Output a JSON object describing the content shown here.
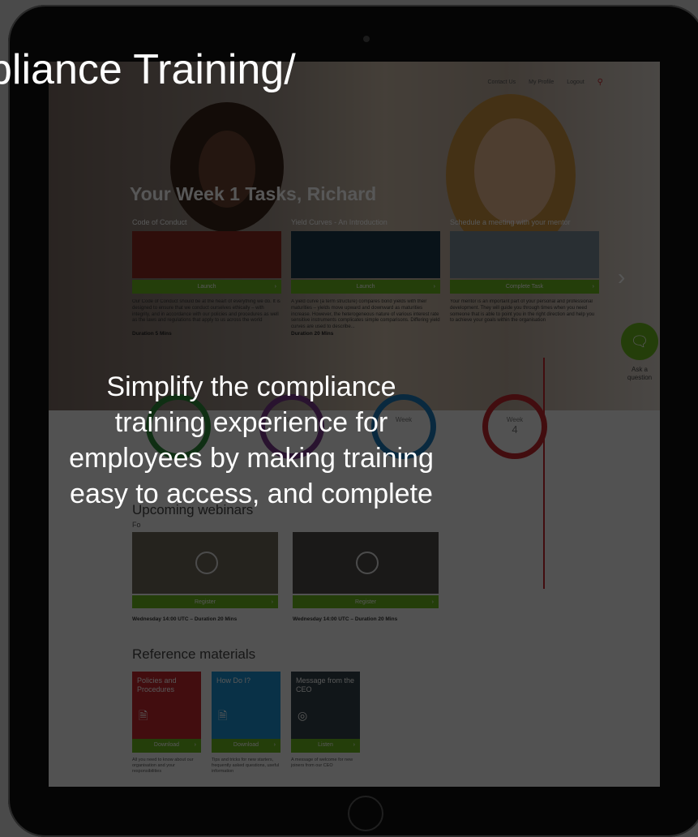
{
  "slide": {
    "title": "pliance Training/",
    "body_lines": [
      "Simplify the compliance",
      "training experience for",
      "employees by making training",
      "easy to access, and complete"
    ]
  },
  "nav": {
    "links": [
      "Contact Us",
      "My Profile",
      "Logout"
    ],
    "search_icon": "search-icon"
  },
  "week_title": "Your Week 1 Tasks, Richard",
  "tasks": [
    {
      "title": "Code of Conduct",
      "button": "Launch",
      "desc": "Our Code of Conduct should be at the heart of everything we do. It is designed to ensure that we conduct ourselves ethically – with integrity, and in accordance with our policies and procedures as well as the laws and regulations that apply to us across the world",
      "duration": "Duration 5 Mins"
    },
    {
      "title": "Yield Curves - An Introduction",
      "button": "Launch",
      "desc": "A yield curve (a term structure) compares bond yields with their maturities – yields move upward and downward as maturities increase. However, the heterogeneous nature of various interest rate sensitive instruments complicates simple comparisons. Differing yield curves are used to describe...",
      "duration": "Duration 20 Mins"
    },
    {
      "title": "Schedule a meeting with your mentor",
      "button": "Complete Task",
      "desc": "Your mentor is an important part of your personal and professional development. They will guide you through times when you need someone that is able to point you in the right direction and help you to achieve your goals within the organisation",
      "duration": ""
    }
  ],
  "ask": {
    "label": "Ask a question"
  },
  "weeks": [
    {
      "label": "Week",
      "number": ""
    },
    {
      "label": "Week",
      "number": ""
    },
    {
      "label": "Week",
      "number": ""
    },
    {
      "label": "Week",
      "number": "4"
    }
  ],
  "webinars": {
    "title": "Upcoming webinars",
    "subtitle": "Fo",
    "items": [
      {
        "button": "Register",
        "info": "Wednesday 14:00 UTC – Duration 20 Mins"
      },
      {
        "button": "Register",
        "info": "Wednesday 14:00 UTC – Duration 20 Mins"
      }
    ]
  },
  "references": {
    "title": "Reference materials",
    "items": [
      {
        "title": "Policies and Procedures",
        "file": "PDF",
        "button": "Download",
        "desc": "All you need to know about our organisation and your responsibilities",
        "color": "#c0262d"
      },
      {
        "title": "How Do I?",
        "file": "PowerPoint",
        "button": "Download",
        "desc": "Tips and tricks for new starters, frequently asked questions, useful information",
        "color": "#1b8fd0"
      },
      {
        "title": "Message from the CEO",
        "file": "Podcast",
        "button": "Listen",
        "desc": "A message of welcome for new joiners from our CEO",
        "color": "#33424a"
      }
    ]
  },
  "colors": {
    "accent_green": "#6bb51f",
    "accent_red": "#c0262d"
  }
}
